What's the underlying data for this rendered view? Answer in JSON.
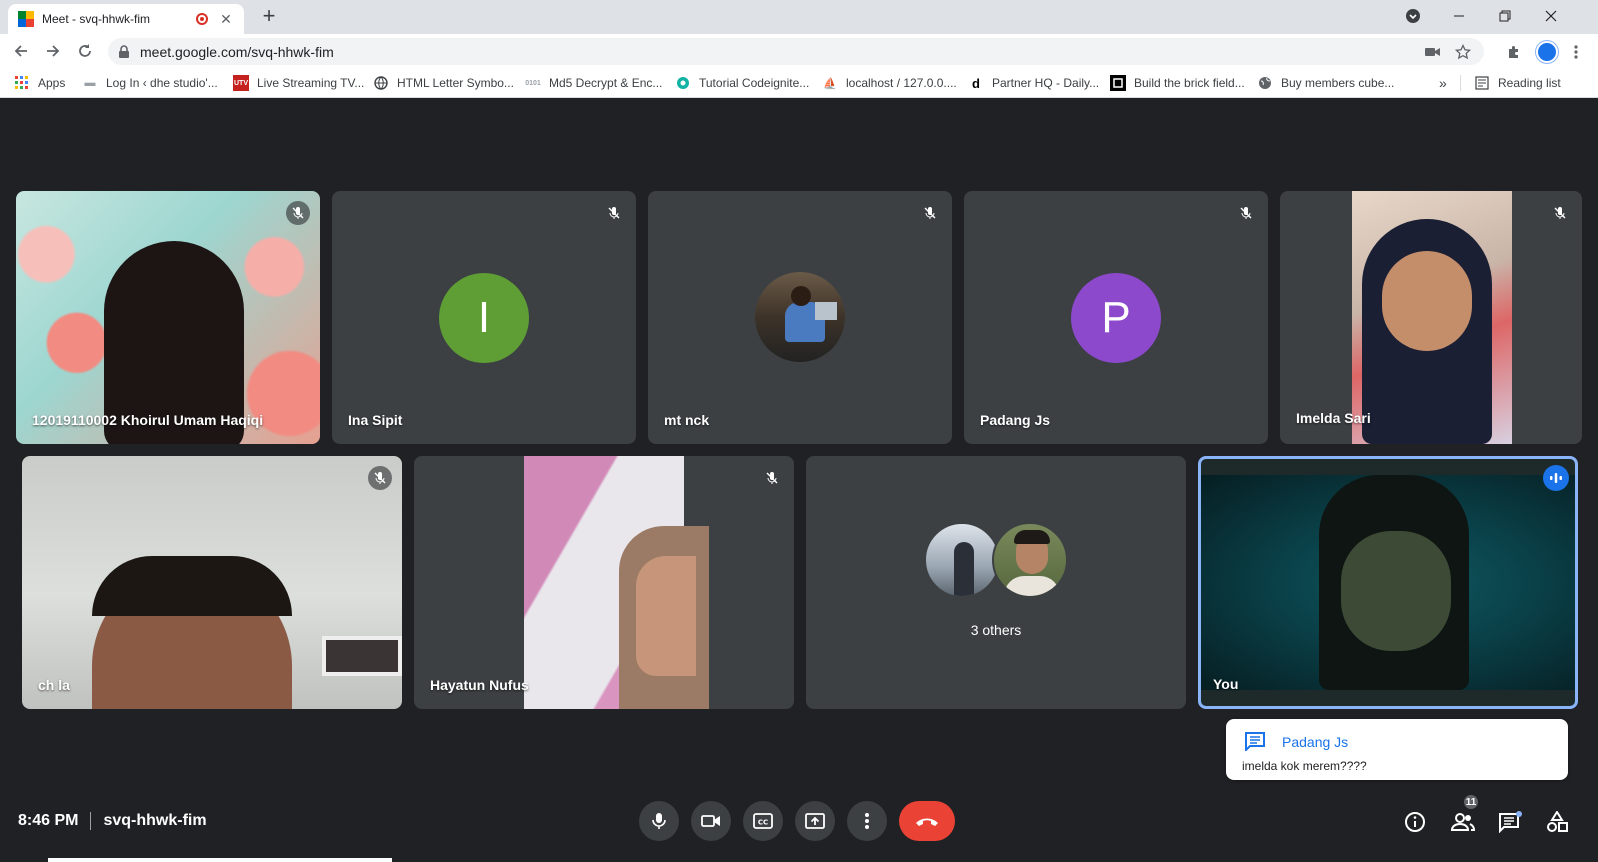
{
  "browser": {
    "tab_title": "Meet - svq-hhwk-fim",
    "url": "meet.google.com/svq-hhwk-fim",
    "bookmarks": [
      "Apps",
      "Log In ‹ dhe studio'...",
      "Live Streaming TV...",
      "HTML Letter Symbo...",
      "Md5 Decrypt & Enc...",
      "Tutorial Codeignite...",
      "localhost / 127.0.0....",
      "Partner HQ - Daily...",
      "Build the brick field...",
      "Buy members cube...",
      "Reading list"
    ],
    "more_bookmarks": "»"
  },
  "participants": [
    {
      "name": "12019110002 Khoirul Umam Haqiqi",
      "muted": true,
      "video": true
    },
    {
      "name": "Ina Sipit",
      "muted": true,
      "video": false,
      "initial": "I",
      "color": "#5e9e35"
    },
    {
      "name": "mt nck",
      "muted": true,
      "video": false,
      "photo_avatar": true
    },
    {
      "name": "Padang Js",
      "muted": true,
      "video": false,
      "initial": "P",
      "color": "#8c49cc"
    },
    {
      "name": "Imelda Sari",
      "muted": true,
      "video": true
    },
    {
      "name": "ch la",
      "muted": true,
      "video": true
    },
    {
      "name": "Hayatun Nufus",
      "muted": true,
      "video": true
    },
    {
      "name": "3 others",
      "muted": false,
      "video": false
    },
    {
      "name": "You",
      "muted": false,
      "video": true,
      "speaking": true
    }
  ],
  "chat_toast": {
    "sender": "Padang Js",
    "message": "imelda kok merem????"
  },
  "meeting": {
    "time": "8:46 PM",
    "code": "svq-hhwk-fim",
    "participant_count": "11"
  },
  "colors": {
    "stage_bg": "#202124",
    "tile_bg": "#3c4043",
    "hangup": "#ea4335",
    "accent": "#1a73e8",
    "speaking_border": "#8ab4f8"
  }
}
